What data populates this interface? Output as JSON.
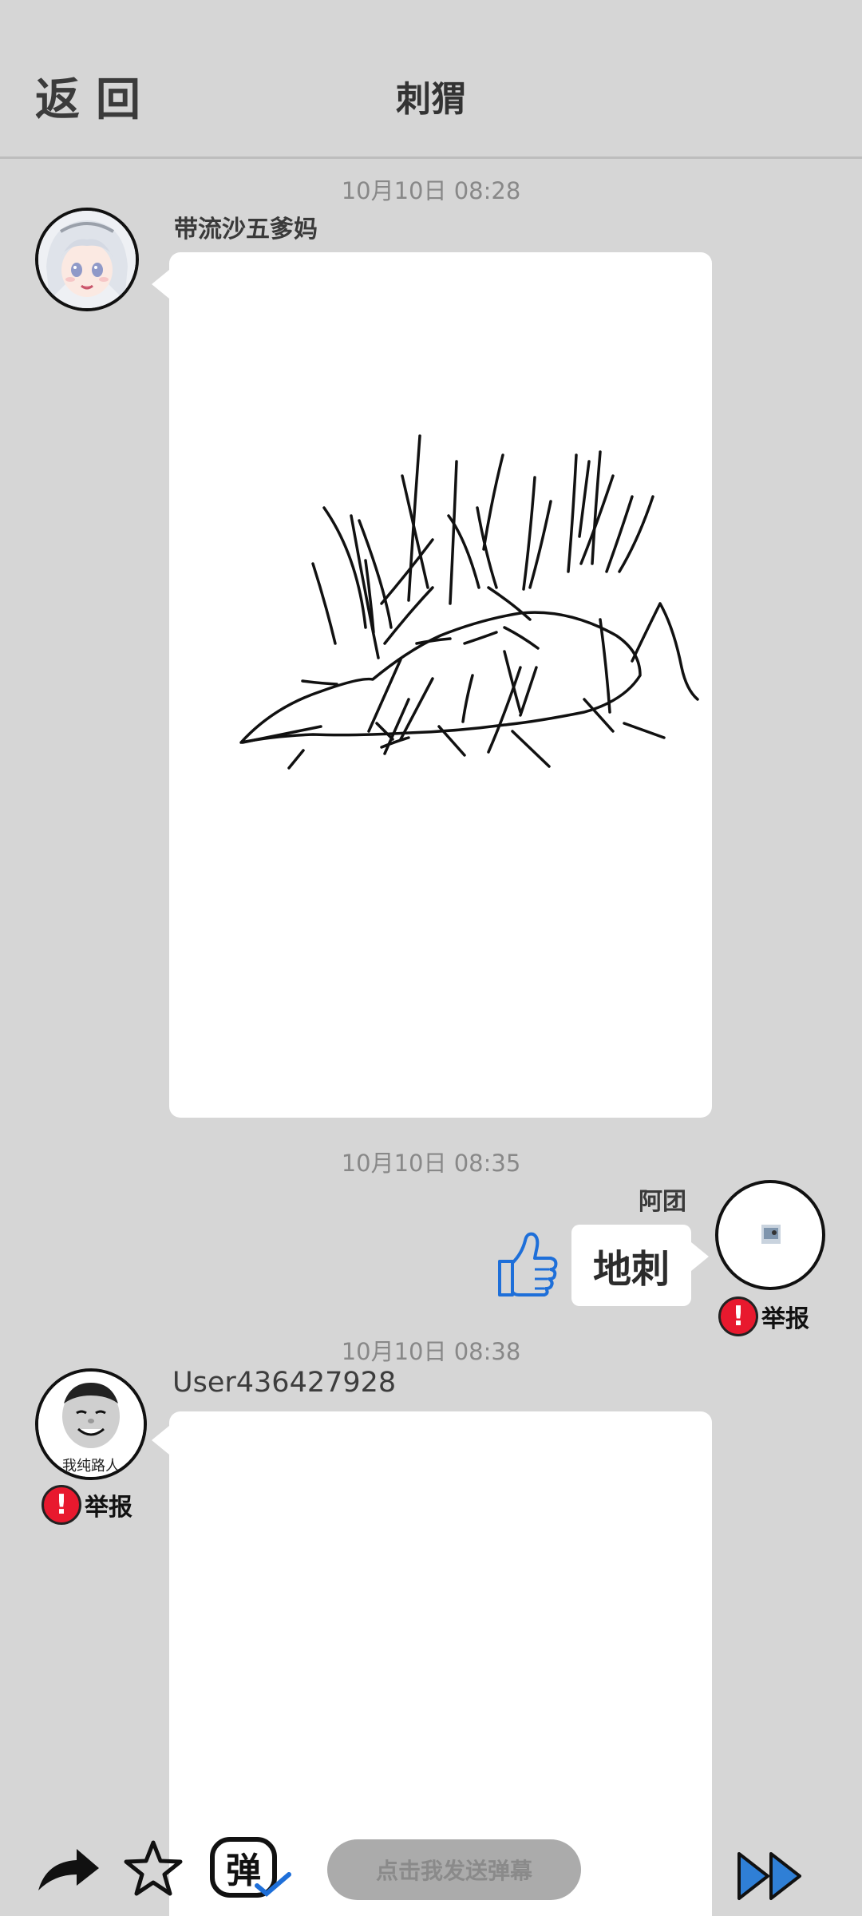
{
  "header": {
    "back_label": "返回",
    "title": "刺猬"
  },
  "messages": [
    {
      "timestamp": "10月10日 08:28",
      "sender": "带流沙五爹妈",
      "type": "drawing"
    },
    {
      "timestamp": "10月10日 08:35",
      "sender": "阿团",
      "text": "地刺",
      "report_label": "举报"
    },
    {
      "timestamp": "10月10日 08:38",
      "sender": "User436427928",
      "avatar_caption": "我纯路人",
      "report_label": "举报",
      "type": "drawing"
    }
  ],
  "toolbar": {
    "share_icon": "share-arrow-icon",
    "star_icon": "star-icon",
    "danmaku_icon_text": "弹",
    "danmaku_placeholder": "点击我发送弹幕",
    "next_icon": "fast-forward-icon"
  },
  "colors": {
    "background": "#d6d6d6",
    "bubble": "#ffffff",
    "report": "#e8192e",
    "like": "#1e6fd9",
    "next": "#2f7fd6"
  }
}
